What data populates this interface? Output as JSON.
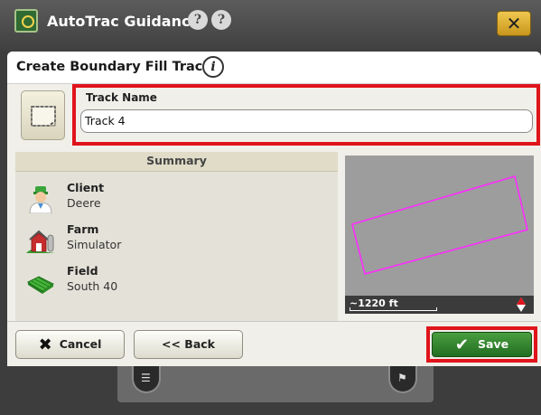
{
  "titlebar": {
    "app_title": "AutoTrac Guidance",
    "help_icon_1": "?",
    "help_icon_2": "?",
    "close_label": "✕"
  },
  "dialog": {
    "title": "Create Boundary Fill Track",
    "info_icon": "i"
  },
  "track_name": {
    "label": "Track Name",
    "value": "Track 4"
  },
  "summary": {
    "heading": "Summary",
    "items": [
      {
        "title": "Client",
        "value": "Deere",
        "icon": "client-person-icon"
      },
      {
        "title": "Farm",
        "value": "Simulator",
        "icon": "farm-barn-icon"
      },
      {
        "title": "Field",
        "value": "South 40",
        "icon": "field-icon"
      }
    ]
  },
  "map": {
    "scale_label": "~1220 ft",
    "boundary_color": "#ff2bff",
    "background_color": "#9d9d9d"
  },
  "footer": {
    "cancel_label": "Cancel",
    "back_label": "<< Back",
    "save_label": "Save"
  },
  "colors": {
    "highlight": "#e0141b",
    "save_green": "#2f7f2b",
    "accent_yellow": "#e8b734"
  }
}
